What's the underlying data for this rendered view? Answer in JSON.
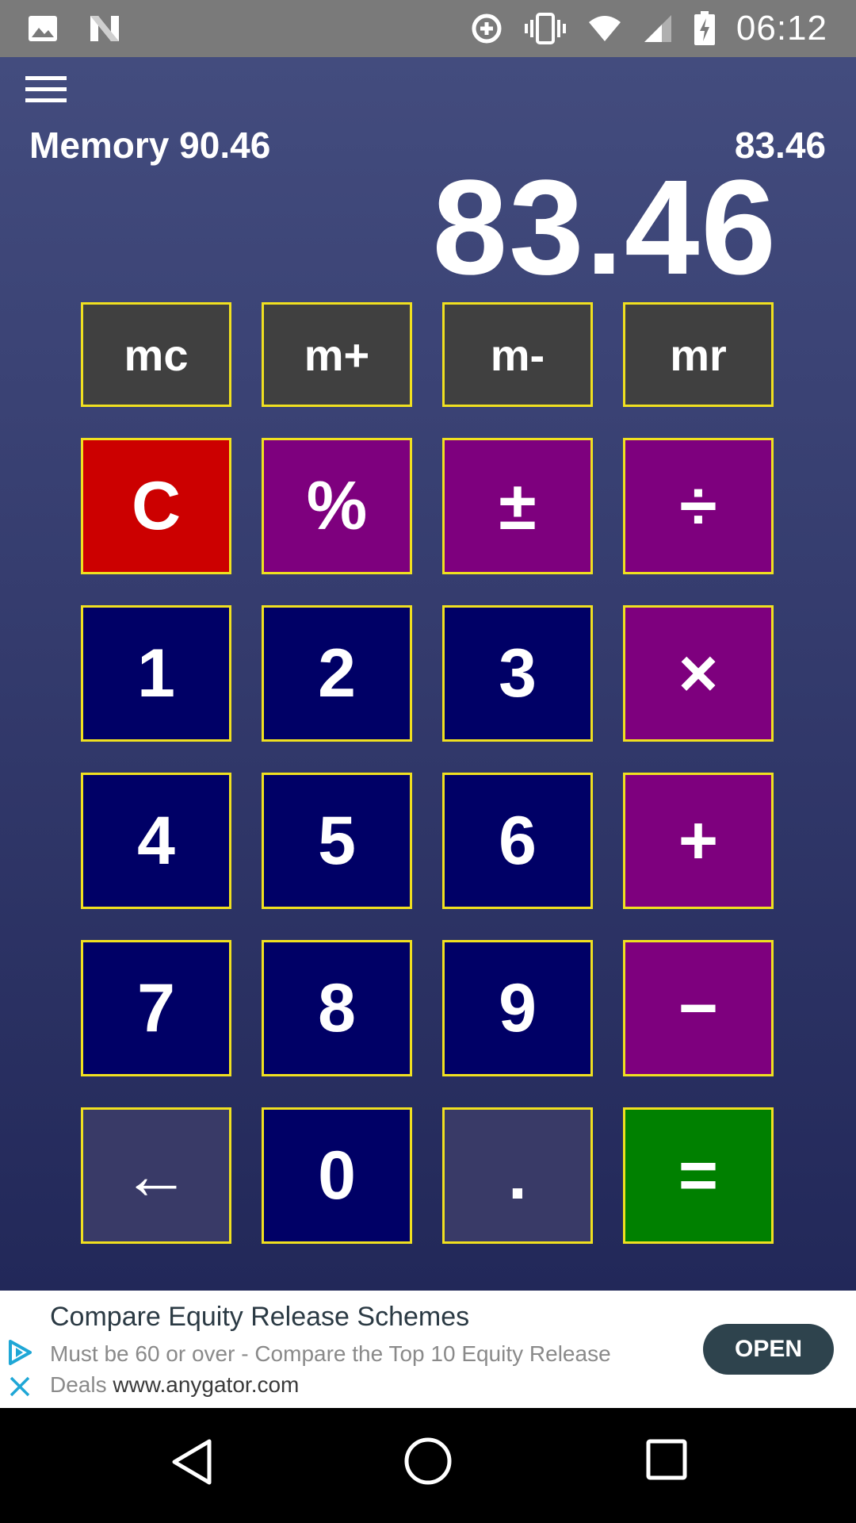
{
  "status_bar": {
    "time": "06:12",
    "icons": [
      "image-icon",
      "n-icon",
      "data-saver-icon",
      "vibrate-icon",
      "wifi-icon",
      "signal-icon",
      "battery-charging-icon"
    ]
  },
  "display": {
    "memory_text": "Memory 90.46",
    "sub_value": "83.46",
    "main_value": "83.46"
  },
  "memory_keys": [
    "mc",
    "m+",
    "m-",
    "mr"
  ],
  "keys": {
    "clear": "C",
    "percent": "%",
    "plus_minus": "±",
    "divide": "÷",
    "one": "1",
    "two": "2",
    "three": "3",
    "multiply": "×",
    "four": "4",
    "five": "5",
    "six": "6",
    "add": "+",
    "seven": "7",
    "eight": "8",
    "nine": "9",
    "subtract": "−",
    "backspace": "←",
    "zero": "0",
    "decimal": ".",
    "equals": "="
  },
  "colors": {
    "key_border": "#f0e020",
    "memory_key": "#404040",
    "number_key": "#000066",
    "operator_key": "#7e007e",
    "clear_key": "#cc0000",
    "equals_key": "#008000"
  },
  "ad": {
    "title": "Compare Equity Release Schemes",
    "body": "Must be 60 or over - Compare the Top 10 Equity Release Deals",
    "url": "www.anygator.com",
    "button": "OPEN"
  },
  "nav": [
    "back-icon",
    "home-icon",
    "recents-icon"
  ]
}
